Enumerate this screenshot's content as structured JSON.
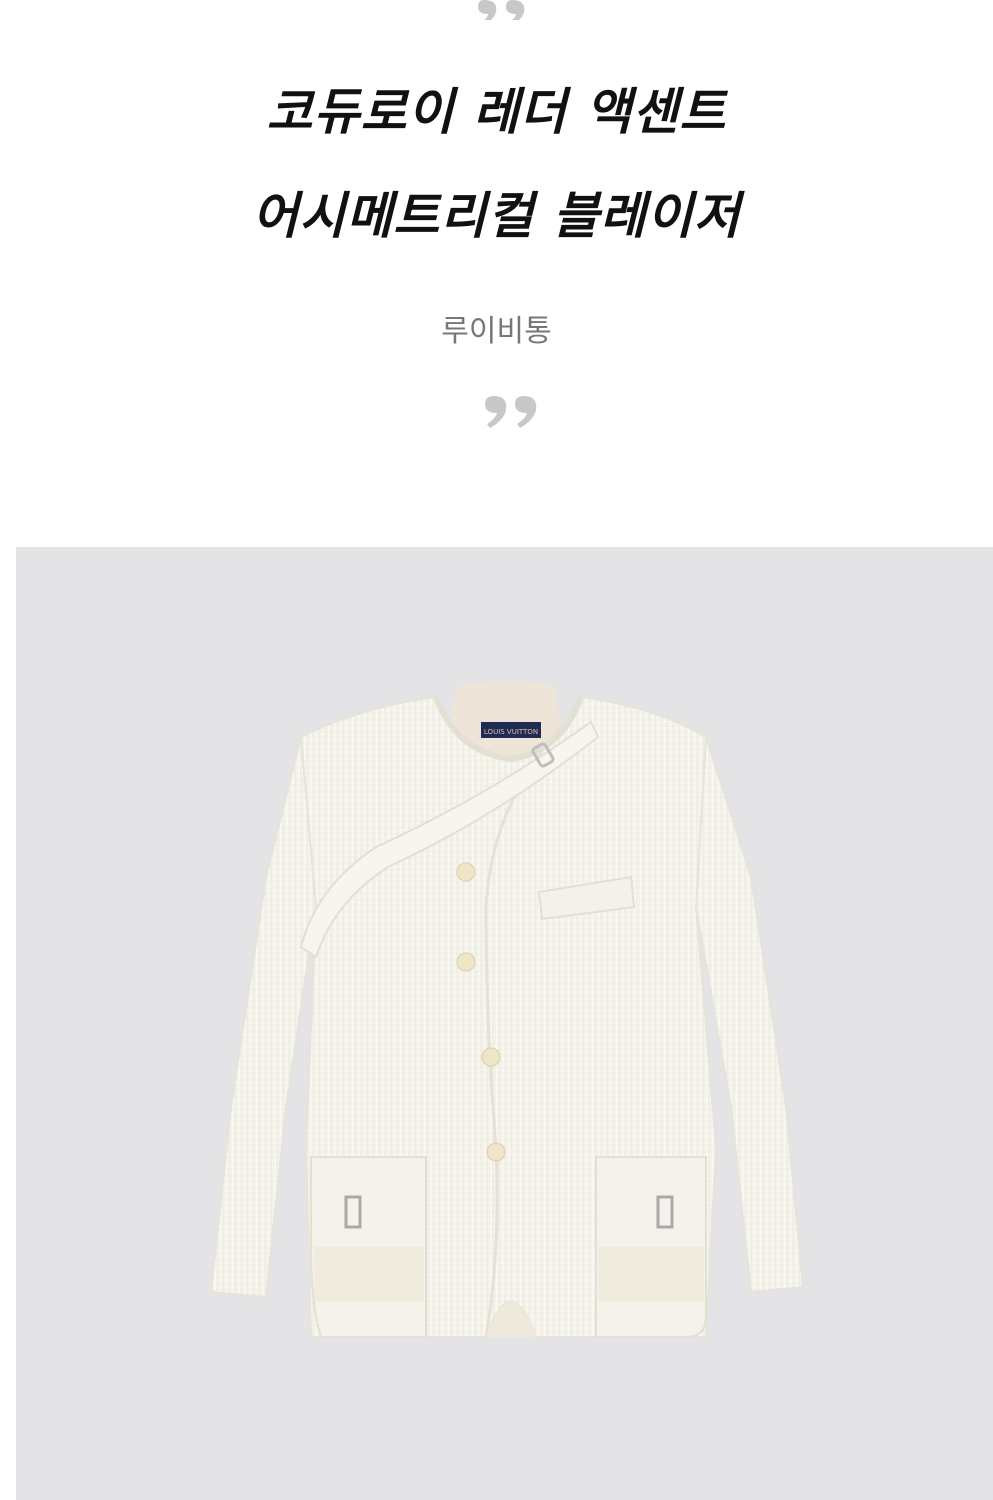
{
  "product": {
    "title_line1": "코듀로이 레더 액센트",
    "title_line2": "어시메트리컬 블레이저",
    "brand": "루이비통",
    "label_text": "LOUIS VUITTON",
    "image_icon": "blazer-illustration"
  },
  "colors": {
    "background": "#ffffff",
    "image_backdrop": "#e4e3e5",
    "quote_mark": "#c8c8c8",
    "title_text": "#111111",
    "brand_text": "#777777"
  }
}
